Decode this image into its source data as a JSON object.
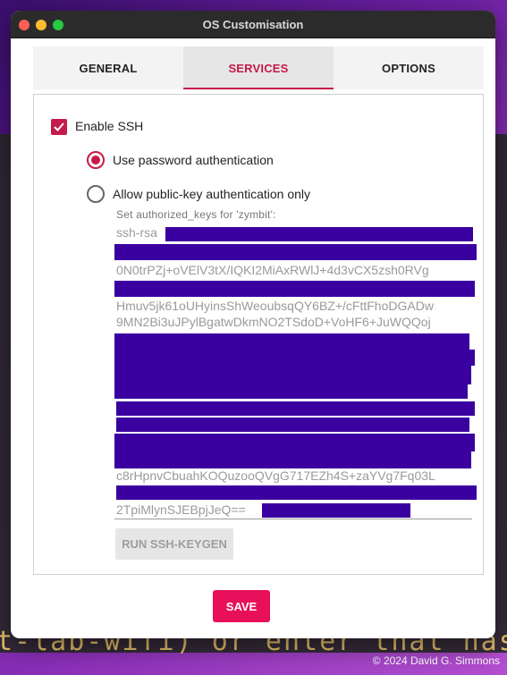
{
  "window": {
    "title": "OS Customisation"
  },
  "tabs": [
    {
      "label": "GENERAL",
      "active": false
    },
    {
      "label": "SERVICES",
      "active": true
    },
    {
      "label": "OPTIONS",
      "active": false
    }
  ],
  "services": {
    "enable_ssh": {
      "label": "Enable SSH",
      "checked": true
    },
    "auth_password": {
      "label": "Use password authentication",
      "selected": true
    },
    "auth_pubkey": {
      "label": "Allow public-key authentication only",
      "selected": false
    },
    "keys_label": "Set authorized_keys for 'zymbit':",
    "key_lines": [
      "ssh-rsa",
      "0N0trPZj+oVElV3tX/IQKI2MiAxRWlJ+4d3vCX5zsh0RVg",
      "Hmuv5jk61oUHyinsShWeoubsqQY6BZ+/cFttFhoDGADw",
      "9MN2Bi3uJPylBgatwDkmNO2TSdoD+VoHF6+JuWQQoj",
      "c8rHpnvCbuahKOQuzooQVgG717EZh4S+zaYVg7Fq03L",
      "2TpiMlynSJEBpjJeQ=="
    ],
    "keygen_button": "RUN SSH-KEYGEN"
  },
  "save_button": "SAVE",
  "background": {
    "terminal_text": "t-lab-wifi) or enter that has",
    "copyright": "© 2024 David G. Simmons"
  },
  "colors": {
    "accent": "#c51a4a",
    "save": "#e8105a",
    "redaction": "#3a00a0"
  }
}
